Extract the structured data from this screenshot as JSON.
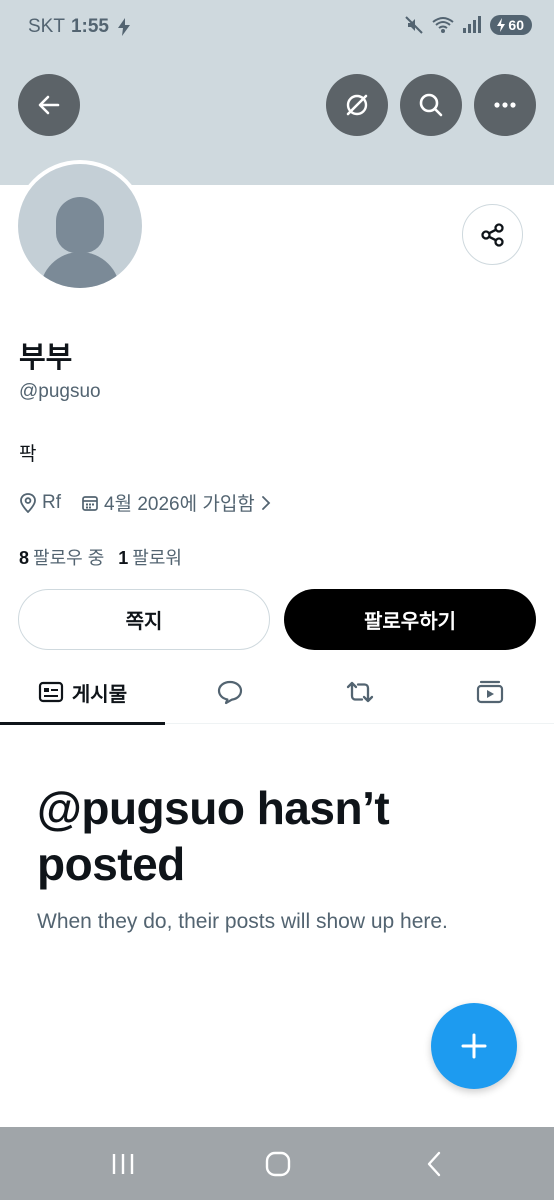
{
  "status_bar": {
    "carrier": "SKT",
    "time": "1:55",
    "battery": "60"
  },
  "header": {
    "back_icon": "arrow-left-icon",
    "grok_icon": "grok-icon",
    "search_icon": "search-icon",
    "more_icon": "more-horizontal-icon",
    "banner_color": "#cfd9de"
  },
  "profile": {
    "display_name": "부부",
    "handle": "@pugsuo",
    "bio": "팍",
    "location": "Rf",
    "joined": "4월 2026에 가입함",
    "following_count": "8",
    "following_label": "팔로우 중",
    "followers_count": "1",
    "followers_label": "팔로워"
  },
  "actions": {
    "message_label": "쪽지",
    "follow_label": "팔로우하기"
  },
  "tabs": {
    "posts_label": "게시물"
  },
  "empty_state": {
    "title": "@pugsuo hasn’t posted",
    "subtitle": "When they do, their posts will show up here."
  },
  "colors": {
    "accent": "#1d9bf0",
    "text_primary": "#0f1419",
    "text_secondary": "#536471"
  }
}
